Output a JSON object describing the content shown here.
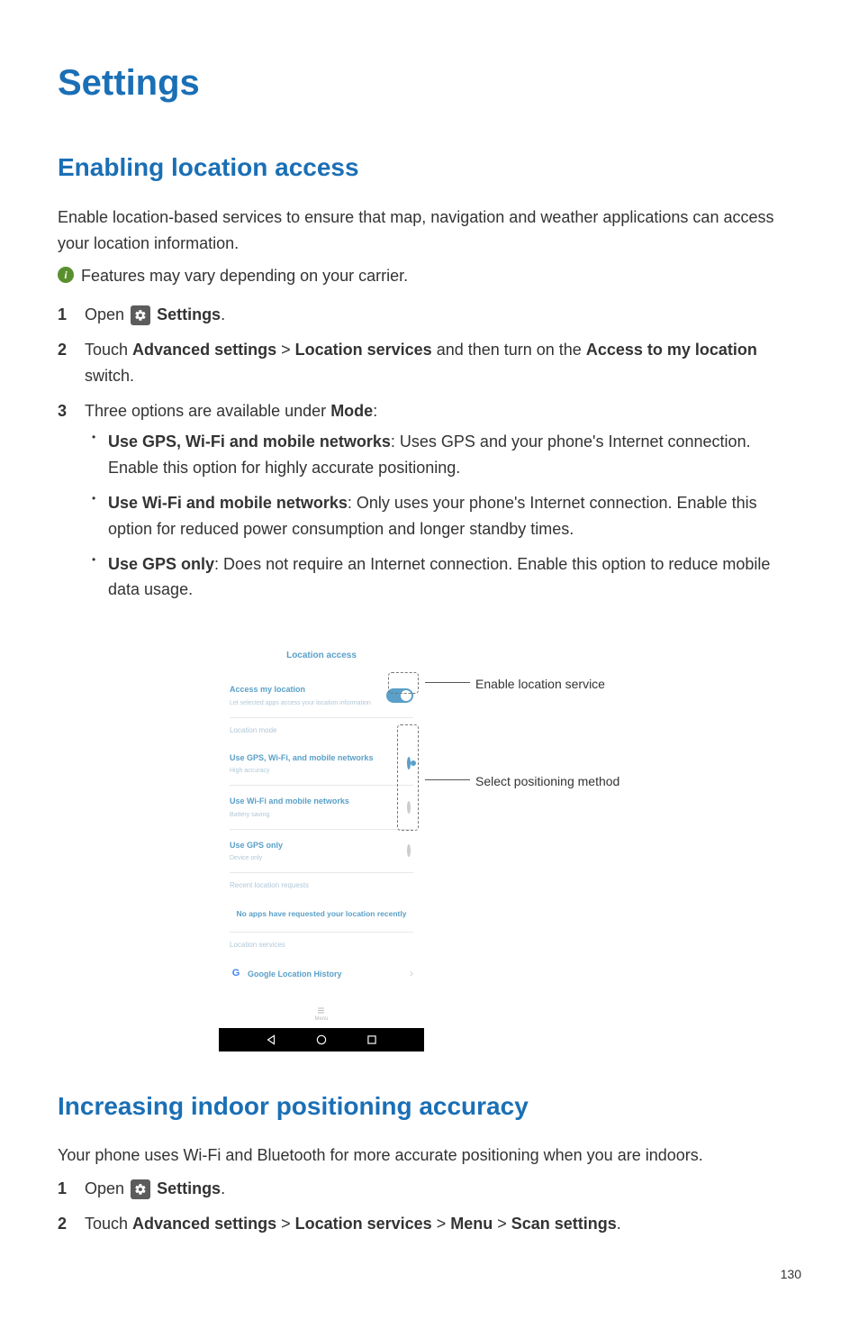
{
  "pageTitle": "Settings",
  "pageNumber": "130",
  "section1": {
    "title": "Enabling location access",
    "intro": "Enable location-based services to ensure that map, navigation and weather applications can access your location information.",
    "note": "Features may vary depending on your carrier.",
    "step1_open": "Open ",
    "step1_settings": "Settings",
    "step1_dot": ".",
    "step2_a": "Touch ",
    "step2_b": "Advanced settings",
    "step2_c": " > ",
    "step2_d": "Location services",
    "step2_e": " and then turn on the ",
    "step2_f": "Access to my location",
    "step2_g": " switch.",
    "step3_a": "Three options are available under ",
    "step3_b": "Mode",
    "step3_c": ":",
    "bul1_a": "Use GPS, Wi-Fi and mobile networks",
    "bul1_b": ": Uses GPS and your phone's Internet connection. Enable this option for highly accurate positioning.",
    "bul2_a": "Use Wi-Fi and mobile networks",
    "bul2_b": ": Only uses your phone's Internet connection. Enable this option for reduced power consumption and longer standby times.",
    "bul3_a": "Use GPS only",
    "bul3_b": ": Does not require an Internet connection. Enable this option to reduce mobile data usage."
  },
  "phone": {
    "title": "Location access",
    "accessTitle": "Access my location",
    "accessSub": "Let selected apps access your location information",
    "locModeLabel": "Location mode",
    "opt1": "Use GPS, Wi-Fi, and mobile networks",
    "opt1sub": "High accuracy",
    "opt2": "Use Wi-Fi and mobile networks",
    "opt2sub": "Battery saving",
    "opt3": "Use GPS only",
    "opt3sub": "Device only",
    "recentLabel": "Recent location requests",
    "noRecent": "No apps have requested your location recently",
    "locServLabel": "Location services",
    "ghist": "Google Location History",
    "menu": "Menu"
  },
  "annotations": {
    "enable": "Enable location service",
    "select": "Select positioning method"
  },
  "section2": {
    "title": "Increasing indoor positioning accuracy",
    "intro": "Your phone uses Wi-Fi and Bluetooth for more accurate positioning when you are indoors.",
    "step1_open": "Open ",
    "step1_settings": "Settings",
    "step1_dot": ".",
    "step2_a": "Touch ",
    "step2_b": "Advanced settings",
    "step2_c": " > ",
    "step2_d": "Location services",
    "step2_e": " > ",
    "step2_f": "Menu",
    "step2_g": " > ",
    "step2_h": "Scan settings",
    "step2_i": "."
  }
}
